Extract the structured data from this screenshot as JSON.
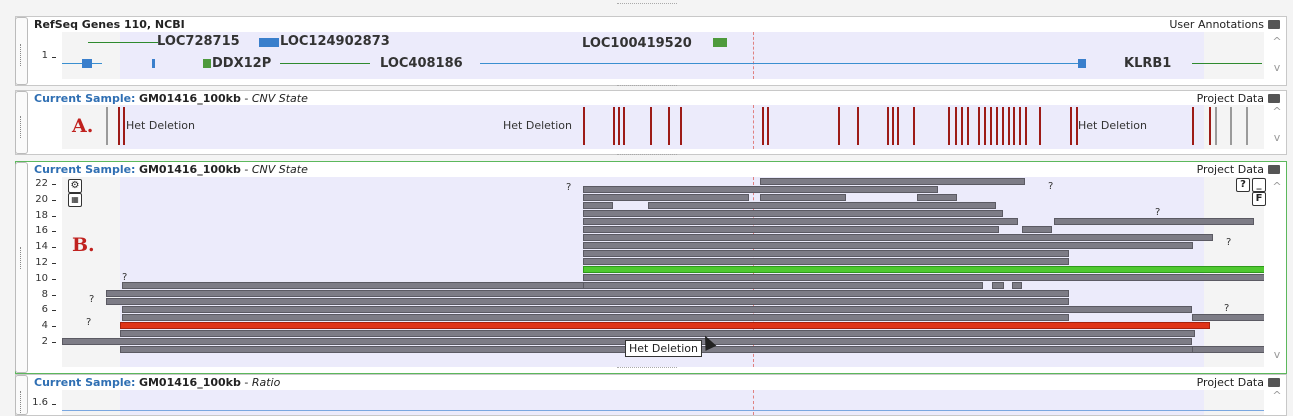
{
  "genes_panel": {
    "title": "RefSeq Genes 110, NCBI",
    "right_label": "User Annotations",
    "ytick": "1",
    "genes": [
      "LOC728715",
      "LOC124902873",
      "LOC100419520",
      "DDX12P",
      "LOC408186",
      "KLRB1"
    ]
  },
  "cnv_panel_a": {
    "title_prefix": "Current Sample:",
    "sample": "GM01416_100kb",
    "separator": " - ",
    "track": "CNV State",
    "right_label": "Project Data",
    "marker": "A.",
    "annotations": [
      "Het Deletion",
      "Het Deletion",
      "Het Deletion"
    ]
  },
  "cnv_panel_b": {
    "title_prefix": "Current Sample:",
    "sample": "GM01416_100kb",
    "separator": " - ",
    "track": "CNV State",
    "right_label": "Project Data",
    "marker": "B.",
    "yticks": [
      "22",
      "20",
      "18",
      "16",
      "14",
      "12",
      "10",
      "8",
      "6",
      "4",
      "2"
    ],
    "question_mark": "?",
    "tooltip": "Het Deletion",
    "buttons": [
      "?",
      "_",
      "F"
    ],
    "colors": {
      "loss": "#7d7c86",
      "gain": "#4fc830",
      "deletion": "#e03418"
    }
  },
  "ratio_panel": {
    "title_prefix": "Current Sample:",
    "sample": "GM01416_100kb",
    "separator": " - ",
    "track": "Ratio",
    "right_label": "Project Data",
    "ytick": "1.6"
  }
}
